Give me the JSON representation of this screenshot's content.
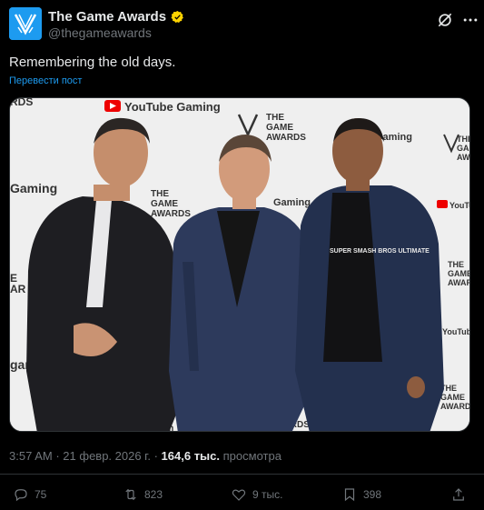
{
  "author": {
    "display_name": "The Game Awards",
    "handle": "@thegameawards",
    "avatar_icon": "tga-logo-icon",
    "verified_badge": "gold-checkmark-icon"
  },
  "tweet": {
    "text": "Remembering the old days.",
    "translate_label": "Перевести пост"
  },
  "media": {
    "photo": {
      "backdrop_text": {
        "youtube_gaming": "YouTube Gaming",
        "gaming": "Gaming",
        "the_game_awards": "THE GAME AWARDS"
      },
      "shirt_text": "SUPER SMASH BROS ULTIMATE"
    }
  },
  "meta": {
    "time": "3:57 AM",
    "separator": "·",
    "date": "21 февр. 2026 г.",
    "views_count": "164,6 тыс.",
    "views_label": "просмотра"
  },
  "actions": {
    "replies": "75",
    "reposts": "823",
    "likes": "9 тыс.",
    "bookmarks": "398"
  },
  "colors": {
    "background": "#000000",
    "accent": "#1d9bf0",
    "muted": "#71767b",
    "verified": "#ffd400"
  }
}
